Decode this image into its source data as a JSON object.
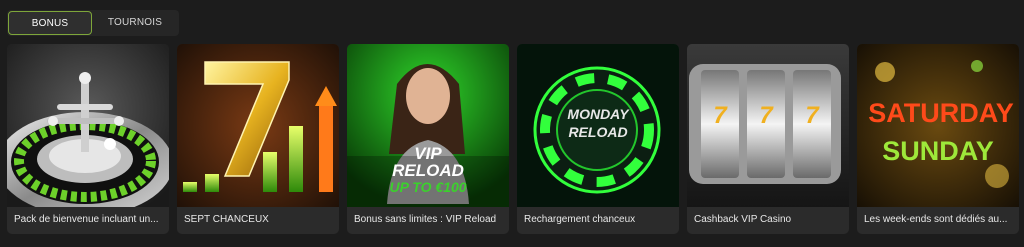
{
  "tabs": [
    {
      "label": "BONUS",
      "active": true
    },
    {
      "label": "TOURNOIS",
      "active": false
    }
  ],
  "colors": {
    "accent": "#7ea63a",
    "card_bg": "#2b2b2b",
    "page_bg": "#1c1c1c"
  },
  "cards": [
    {
      "title": "Pack de bienvenue incluant un...",
      "visual": "roulette-wheel"
    },
    {
      "title": "SEPT CHANCEUX",
      "visual": "golden-seven-with-bars"
    },
    {
      "title": "Bonus sans limites : VIP Reload",
      "visual": "woman-promo",
      "promo_line1": "VIP",
      "promo_line2": "RELOAD",
      "promo_line3": "UP TO €100"
    },
    {
      "title": "Rechargement chanceux",
      "visual": "neon-chip",
      "promo_line1": "MONDAY",
      "promo_line2": "RELOAD"
    },
    {
      "title": "Cashback VIP Casino",
      "visual": "slot-reels",
      "reel_symbols": [
        "7",
        "7",
        "7"
      ]
    },
    {
      "title": "Les week-ends sont dédiés au...",
      "visual": "weekend-banner",
      "promo_line1": "SATURDAY",
      "promo_line2": "SUNDAY"
    }
  ]
}
